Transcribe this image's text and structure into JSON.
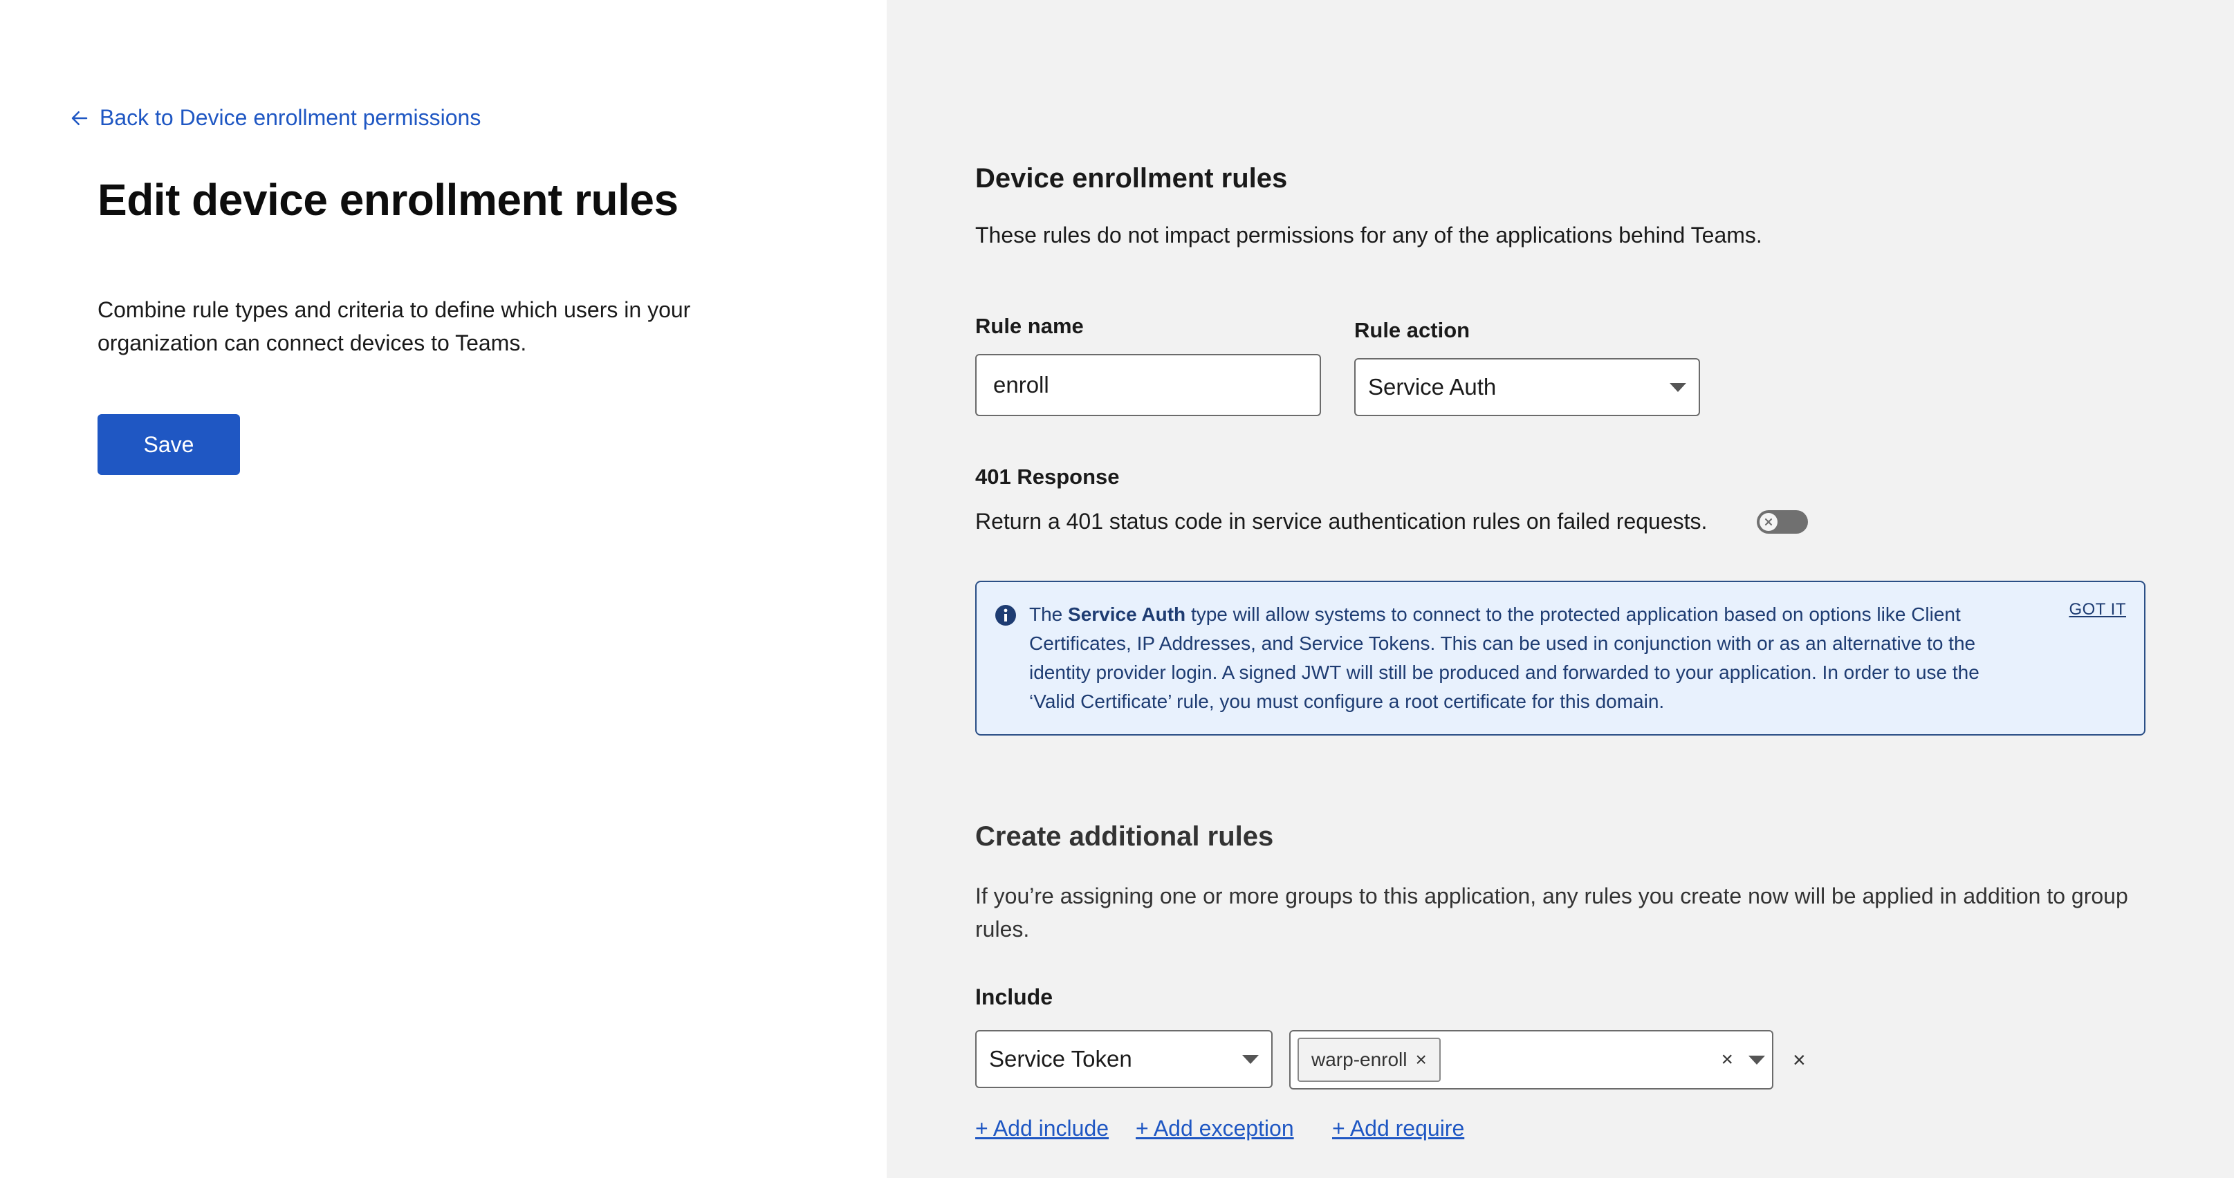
{
  "left": {
    "back_link": "Back to Device enrollment permissions",
    "title": "Edit device enrollment rules",
    "description": "Combine rule types and criteria to define which users in your organization can connect devices to Teams.",
    "save_label": "Save"
  },
  "rules": {
    "title": "Device enrollment rules",
    "description": "These rules do not impact permissions for any of the applications behind Teams.",
    "rule_name_label": "Rule name",
    "rule_name_value": "enroll",
    "rule_action_label": "Rule action",
    "rule_action_value": "Service Auth",
    "response_label": "401 Response",
    "response_text": "Return a 401 status code in service authentication rules on failed requests.",
    "response_enabled": false
  },
  "info": {
    "prefix": "The ",
    "bold": "Service Auth",
    "body": " type will allow systems to connect to the protected application based on options like Client Certificates, IP Addresses, and Service Tokens. This can be used in conjunction with or as an alternative to the identity provider login. A signed JWT will still be produced and forwarded to your application. In order to use the ‘Valid Certificate’ rule, you must configure a root certificate for this domain.",
    "dismiss": "GOT IT"
  },
  "additional": {
    "title": "Create additional rules",
    "description": "If you’re assigning one or more groups to this application, any rules you create now will be applied in addition to group rules.",
    "include_label": "Include",
    "selector_value": "Service Token",
    "chip": "warp-enroll",
    "add_include": "+ Add include",
    "add_exception": "+ Add exception",
    "add_require": "+ Add require"
  },
  "colors": {
    "accent": "#1f57c3",
    "info_bg": "#e8f1fd",
    "info_border": "#2b4f86",
    "right_bg": "#f2f2f2"
  }
}
